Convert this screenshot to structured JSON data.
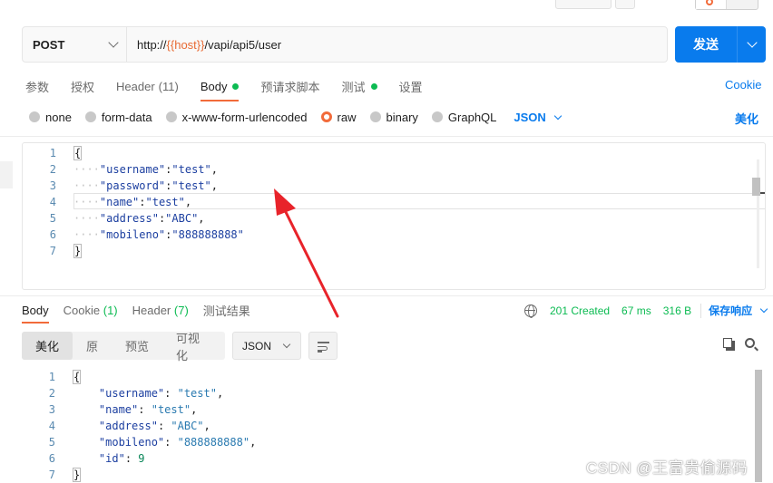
{
  "request": {
    "method": "POST",
    "url_prefix": "http://",
    "url_variable": "{{host}}",
    "url_suffix": "/vapi/api5/user",
    "send_label": "发送"
  },
  "request_tabs": [
    {
      "label": "参数",
      "count": ""
    },
    {
      "label": "授权",
      "count": ""
    },
    {
      "label": "Header",
      "count": "(11)"
    },
    {
      "label": "Body",
      "count": ""
    },
    {
      "label": "预请求脚本",
      "count": ""
    },
    {
      "label": "测试",
      "count": ""
    },
    {
      "label": "设置",
      "count": ""
    }
  ],
  "cookie_link": "Cookie",
  "body_types": [
    "none",
    "form-data",
    "x-www-form-urlencoded",
    "raw",
    "binary",
    "GraphQL"
  ],
  "body_format": "JSON",
  "beautify_label": "美化",
  "request_body_lines": [
    {
      "n": "1",
      "text": "{"
    },
    {
      "n": "2",
      "key": "\"username\"",
      "val": "\"test\""
    },
    {
      "n": "3",
      "key": "\"password\"",
      "val": "\"test\""
    },
    {
      "n": "4",
      "key": "\"name\"",
      "val": "\"test\""
    },
    {
      "n": "5",
      "key": "\"address\"",
      "val": "\"ABC\""
    },
    {
      "n": "6",
      "key": "\"mobileno\"",
      "val": "\"888888888\""
    },
    {
      "n": "7",
      "text": "}"
    }
  ],
  "response_tabs": [
    {
      "label": "Body",
      "count": ""
    },
    {
      "label": "Cookie",
      "count": "(1)"
    },
    {
      "label": "Header",
      "count": "(7)"
    },
    {
      "label": "测试结果",
      "count": ""
    }
  ],
  "response_status": {
    "code": "201 Created",
    "time": "67 ms",
    "size": "316 B",
    "save_label": "保存响应"
  },
  "view_modes": [
    "美化",
    "原",
    "预览",
    "可视化"
  ],
  "response_format": "JSON",
  "response_body_lines": [
    {
      "n": "1",
      "text": "{"
    },
    {
      "n": "2",
      "key": "\"username\"",
      "val": "\"test\"",
      "num": false
    },
    {
      "n": "3",
      "key": "\"name\"",
      "val": "\"test\"",
      "num": false
    },
    {
      "n": "4",
      "key": "\"address\"",
      "val": "\"ABC\"",
      "num": false
    },
    {
      "n": "5",
      "key": "\"mobileno\"",
      "val": "\"888888888\"",
      "num": false
    },
    {
      "n": "6",
      "key": "\"id\"",
      "val": "9",
      "num": true
    },
    {
      "n": "7",
      "text": "}"
    }
  ],
  "watermark": "CSDN @王富贵偷源码",
  "icons": {
    "globe": "globe-icon",
    "copy": "copy-icon",
    "search": "search-icon",
    "wrap": "wrap-lines-icon",
    "annotation": "red-arrow-annotation"
  },
  "colors": {
    "accent": "#f26b3a",
    "primary": "#097bed",
    "success": "#0cbb52",
    "json_key": "#1c3fa0",
    "json_string": "#2a7ab0",
    "json_number": "#098658"
  }
}
